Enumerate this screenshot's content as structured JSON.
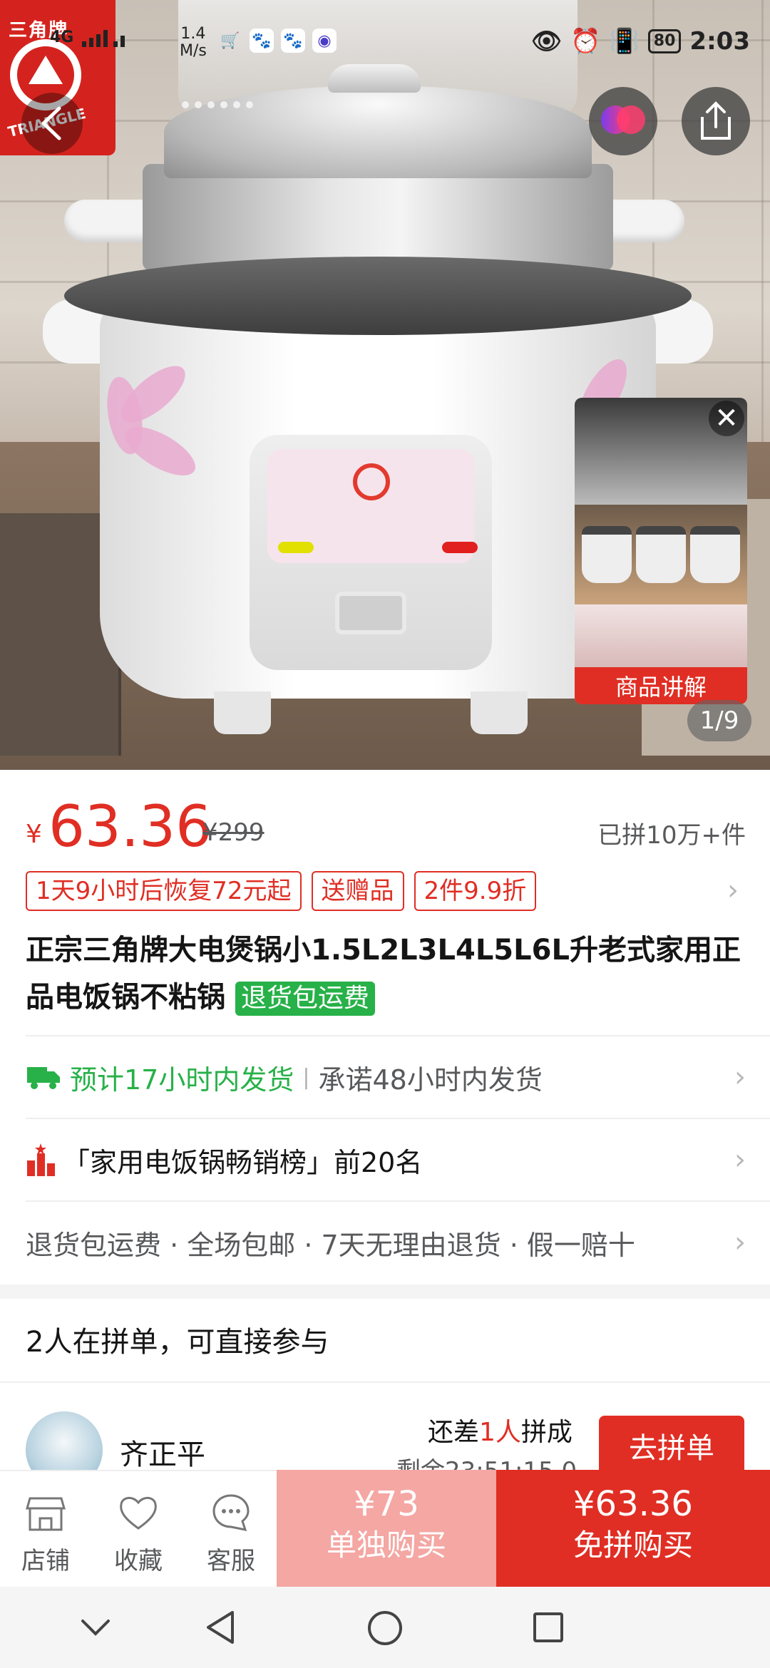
{
  "status_bar": {
    "network": "4G",
    "speed_value": "1.4",
    "speed_unit": "M/s",
    "battery": "80",
    "time": "2:03"
  },
  "brand": {
    "name_cn": "三角牌",
    "name_en": "TRIANGLE"
  },
  "product_media": {
    "counter": "1/9",
    "video_label": "商品讲解"
  },
  "price": {
    "currency": "¥",
    "current": "63.36",
    "original": "¥299",
    "sold": "已拼10万+件"
  },
  "promo_tags": [
    "1天9小时后恢复72元起",
    "送赠品",
    "2件9.9折"
  ],
  "title": {
    "text": "正宗三角牌大电煲锅小1.5L2L3L4L5L6L升老式家用正品电饭锅不粘锅",
    "badge": "退货包运费"
  },
  "shipping": {
    "estimate": "预计17小时内发货",
    "promise": "承诺48小时内发货"
  },
  "ranking": {
    "text": "「家用电饭锅畅销榜」前20名"
  },
  "guarantees": {
    "text": "退货包运费 · 全场包邮 · 7天无理由退货 · 假一赔十"
  },
  "group_buy": {
    "title": "2人在拼单，可直接参与",
    "user_name": "齐正平",
    "need_prefix": "还差",
    "need_count": "1人",
    "need_suffix": "拼成",
    "remaining": "剩余23:51:15.0",
    "join_label": "去拼单"
  },
  "bottom_bar": {
    "store": "店铺",
    "favorite": "收藏",
    "service": "客服",
    "alone_price": "¥73",
    "alone_label": "单独购买",
    "group_price": "¥63.36",
    "group_label": "免拼购买"
  },
  "colors": {
    "accent": "#e02e24",
    "green": "#27b148",
    "light_red": "#f4a7a3"
  }
}
